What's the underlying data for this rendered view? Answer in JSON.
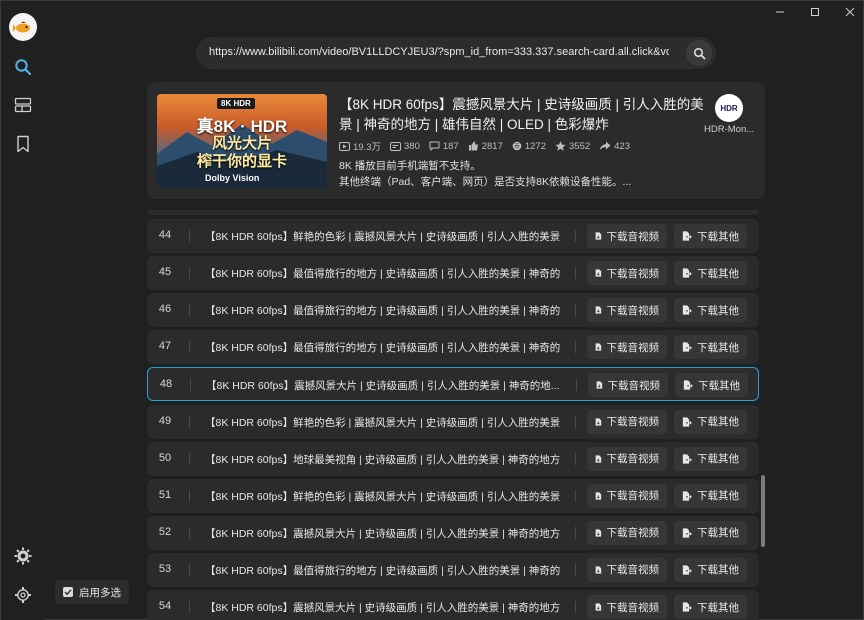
{
  "url": "https://www.bilibili.com/video/BV1LLDCYJEU3/?spm_id_from=333.337.search-card.all.click&vd_so",
  "video": {
    "thumb_badge": "8K HDR",
    "thumb_line1": "真8K · HDR",
    "thumb_line2": "风光大片",
    "thumb_line3": "榨干你的显卡",
    "thumb_dolby": "Dolby Vision",
    "title": "【8K HDR 60fps】震撼风景大片 | 史诗级画质 | 引人入胜的美景 | 神奇的地方 | 雄伟自然 | OLED | 色彩爆炸",
    "stats": {
      "views": "19.3万",
      "danmaku": "380",
      "comments": "187",
      "likes": "2817",
      "coins": "1272",
      "favorites": "3552",
      "shares": "423"
    },
    "desc_line1": "8K 播放目前手机端暂不支持。",
    "desc_line2": "其他终端（Pad、客户端、网页）是否支持8K依赖设备性能。...",
    "uploader_avatar_text": "HDR",
    "uploader_name": "HDR-Mon..."
  },
  "row_buttons": {
    "download_av": "下载音视频",
    "download_other": "下载其他"
  },
  "rows": [
    {
      "num": "44",
      "title": "【8K HDR 60fps】鲜艳的色彩 | 震撼风景大片 | 史诗级画质 | 引人入胜的美景..."
    },
    {
      "num": "45",
      "title": "【8K HDR 60fps】最值得旅行的地方 | 史诗级画质 | 引人入胜的美景 | 神奇的..."
    },
    {
      "num": "46",
      "title": "【8K HDR 60fps】最值得旅行的地方 | 史诗级画质 | 引人入胜的美景 | 神奇的..."
    },
    {
      "num": "47",
      "title": "【8K HDR 60fps】最值得旅行的地方 | 史诗级画质 | 引人入胜的美景 | 神奇的..."
    },
    {
      "num": "48",
      "title": "【8K HDR 60fps】震撼风景大片 | 史诗级画质 | 引人入胜的美景 | 神奇的地..."
    },
    {
      "num": "49",
      "title": "【8K HDR 60fps】鲜艳的色彩 | 震撼风景大片 | 史诗级画质 | 引人入胜的美景..."
    },
    {
      "num": "50",
      "title": "【8K HDR 60fps】地球最美视角 | 史诗级画质 | 引人入胜的美景 | 神奇的地方..."
    },
    {
      "num": "51",
      "title": "【8K HDR 60fps】鲜艳的色彩 | 震撼风景大片 | 史诗级画质 | 引人入胜的美景..."
    },
    {
      "num": "52",
      "title": "【8K HDR 60fps】震撼风景大片 | 史诗级画质 | 引人入胜的美景 | 神奇的地方..."
    },
    {
      "num": "53",
      "title": "【8K HDR 60fps】最值得旅行的地方 | 史诗级画质 | 引人入胜的美景 | 神奇的..."
    },
    {
      "num": "54",
      "title": "【8K HDR 60fps】震撼风景大片 | 史诗级画质 | 引人入胜的美景 | 神奇的地方..."
    }
  ],
  "selected_row": "48",
  "multi_select_label": "启用多选",
  "colors": {
    "background": "#202020",
    "card": "#2b2b2b",
    "button": "#363636",
    "accent": "#2a9fd6",
    "nav_active": "#4fb3e8"
  },
  "icons": {
    "nav": [
      "search-icon",
      "layers-icon",
      "bookmark-icon"
    ],
    "bottom": [
      "theme-icon",
      "gear-icon"
    ]
  }
}
